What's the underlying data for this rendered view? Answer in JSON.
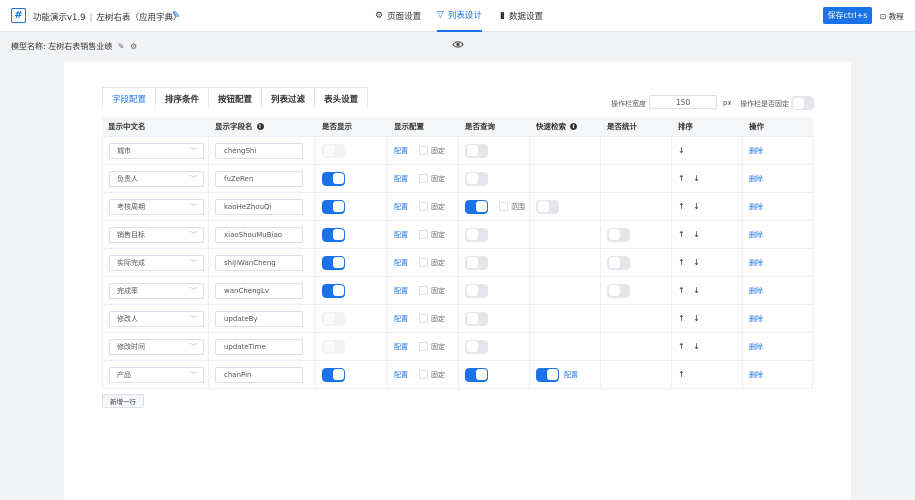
{
  "header": {
    "logo": "#",
    "app_name": "功能演示v1.9",
    "separator": "|",
    "page_name": "左树右表（应用字典）",
    "nav": [
      {
        "label": "页面设置",
        "icon": "gear-icon",
        "active": false
      },
      {
        "label": "列表设计",
        "icon": "list-design-icon",
        "active": true
      },
      {
        "label": "数据设置",
        "icon": "bar-chart-icon",
        "active": false
      }
    ],
    "save_label": "保存ctrl+s",
    "tutorial_label": "教程"
  },
  "model": {
    "label": "模型名称:",
    "name": "左树右表销售业绩"
  },
  "tabs": [
    "字段配置",
    "排序条件",
    "按钮配置",
    "列表过滤",
    "表头设置"
  ],
  "active_tab": 0,
  "op_column": {
    "width_label": "操作栏宽度",
    "width_value": "150",
    "unit": "px",
    "fixed_label": "操作栏是否固定",
    "fixed": false
  },
  "table": {
    "headers": [
      "显示中文名",
      "显示字段名",
      "是否显示",
      "显示配置",
      "是否查询",
      "快速检索",
      "是否统计",
      "排序",
      "操作"
    ],
    "config_link": "配置",
    "fixed_label": "固定",
    "range_label": "范围",
    "delete_label": "删除",
    "rows": [
      {
        "cn": "城市",
        "field": "chengShi",
        "show": "disabled",
        "query": false,
        "range": false,
        "quick": null,
        "quick_config": false,
        "stat": false,
        "sort": "↓"
      },
      {
        "cn": "负责人",
        "field": "fuZeRen",
        "show": "on",
        "query": false,
        "range": false,
        "quick": null,
        "quick_config": false,
        "stat": false,
        "sort": "↑ ↓"
      },
      {
        "cn": "考核周期",
        "field": "kaoHeZhouQi",
        "show": "on",
        "query": true,
        "range": true,
        "quick": false,
        "quick_config": false,
        "stat": false,
        "sort": "↑ ↓"
      },
      {
        "cn": "销售目标",
        "field": "xiaoShouMuBiao",
        "show": "on",
        "query": false,
        "range": false,
        "quick": null,
        "quick_config": false,
        "stat": true,
        "sort": "↑ ↓"
      },
      {
        "cn": "实际完成",
        "field": "shiJiWanCheng",
        "show": "on",
        "query": false,
        "range": false,
        "quick": null,
        "quick_config": false,
        "stat": true,
        "sort": "↑ ↓"
      },
      {
        "cn": "完成率",
        "field": "wanChengLv",
        "show": "on",
        "query": false,
        "range": false,
        "quick": null,
        "quick_config": false,
        "stat": true,
        "sort": "↑ ↓"
      },
      {
        "cn": "修改人",
        "field": "updateBy",
        "show": "disabled",
        "query": false,
        "range": false,
        "quick": null,
        "quick_config": false,
        "stat": false,
        "sort": "↑ ↓"
      },
      {
        "cn": "修改时间",
        "field": "updateTime",
        "show": "disabled",
        "query": false,
        "range": false,
        "quick": null,
        "quick_config": false,
        "stat": false,
        "sort": "↑ ↓"
      },
      {
        "cn": "产品",
        "field": "chanPin",
        "show": "on",
        "query": true,
        "range": false,
        "quick": true,
        "quick_config": true,
        "stat": false,
        "sort": "↑"
      }
    ]
  },
  "add_row_label": "新增一行",
  "colors": {
    "accent": "#1a73e8",
    "toggle_off": "#e4e6eb",
    "border": "#dcdfe6"
  }
}
